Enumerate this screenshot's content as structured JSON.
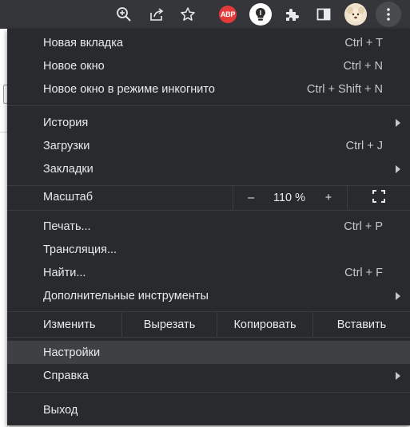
{
  "toolbar": {
    "icons": [
      "zoom-icon",
      "share-icon",
      "star-icon",
      "abp-extension-icon",
      "bulb-extension-icon",
      "extensions-icon",
      "side-panel-icon",
      "avatar",
      "more-icon"
    ],
    "abp_label": "ABP"
  },
  "menu": {
    "new_tab": {
      "label": "Новая вкладка",
      "shortcut": "Ctrl + T"
    },
    "new_window": {
      "label": "Новое окно",
      "shortcut": "Ctrl + N"
    },
    "incognito": {
      "label": "Новое окно в режиме инкогнито",
      "shortcut": "Ctrl + Shift + N"
    },
    "history": {
      "label": "История"
    },
    "downloads": {
      "label": "Загрузки",
      "shortcut": "Ctrl + J"
    },
    "bookmarks": {
      "label": "Закладки"
    },
    "zoom": {
      "label": "Масштаб",
      "minus": "–",
      "value": "110 %",
      "plus": "+"
    },
    "print": {
      "label": "Печать...",
      "shortcut": "Ctrl + P"
    },
    "cast": {
      "label": "Трансляция..."
    },
    "find": {
      "label": "Найти...",
      "shortcut": "Ctrl + F"
    },
    "more_tools": {
      "label": "Дополнительные инструменты"
    },
    "edit": {
      "label": "Изменить",
      "cut": "Вырезать",
      "copy": "Копировать",
      "paste": "Вставить"
    },
    "settings": {
      "label": "Настройки"
    },
    "help": {
      "label": "Справка"
    },
    "exit": {
      "label": "Выход"
    }
  },
  "colors": {
    "menu_bg": "#292a2d",
    "toolbar_bg": "#35363a",
    "highlight": "#3f4044",
    "text": "#e8eaed"
  }
}
